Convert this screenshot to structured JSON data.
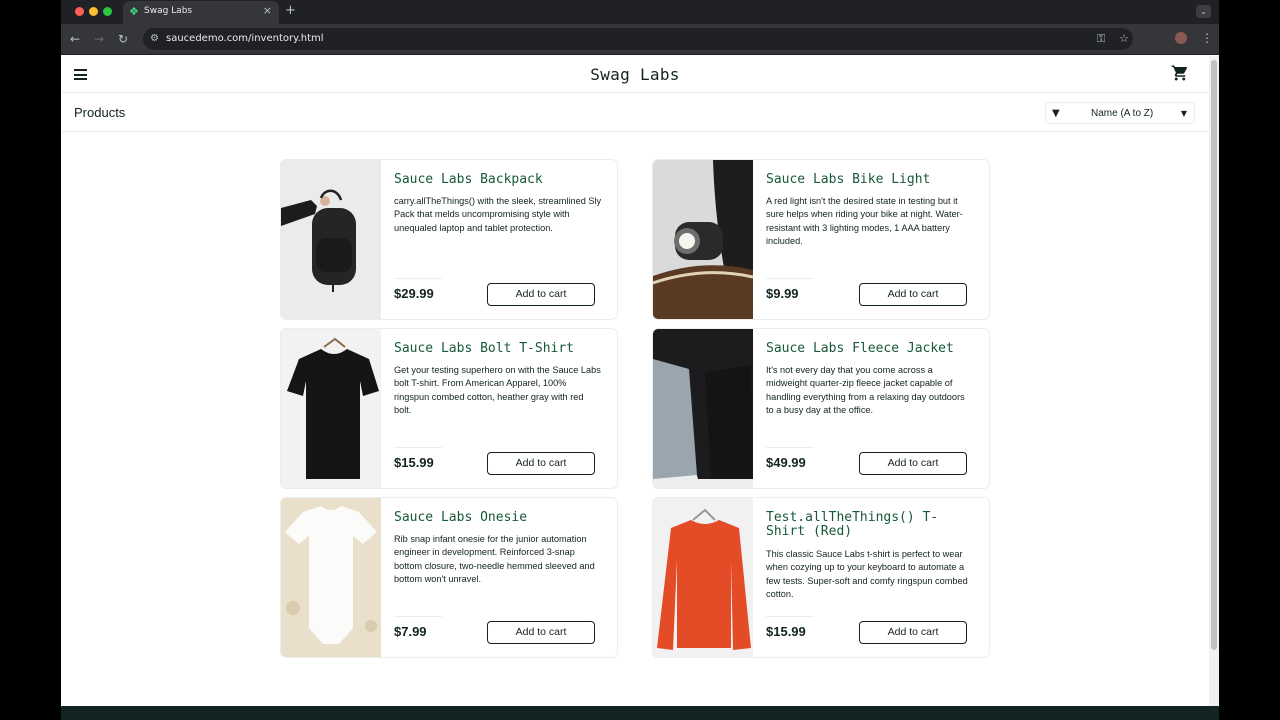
{
  "browser": {
    "tab_title": "Swag Labs",
    "url": "saucedemo.com/inventory.html",
    "colors": {
      "chrome_dark": "#202124",
      "chrome_toolbar": "#35363a",
      "tab_favicon": "#3ddc84"
    }
  },
  "header": {
    "logo": "Swag Labs",
    "menu_icon": "hamburger-menu-icon",
    "cart_icon": "shopping-cart-icon"
  },
  "secondary": {
    "title": "Products",
    "sort": {
      "icon": "funnel-icon",
      "selected": "Name (A to Z)"
    }
  },
  "colors": {
    "text": "#132322",
    "item_name": "#18583a",
    "border": "#ededed"
  },
  "products": [
    {
      "name": "Sauce Labs Backpack",
      "description": "carry.allTheThings() with the sleek, streamlined Sly Pack that melds uncompromising style with unequaled laptop and tablet protection.",
      "price": "$29.99",
      "button": "Add to cart"
    },
    {
      "name": "Sauce Labs Bike Light",
      "description": "A red light isn't the desired state in testing but it sure helps when riding your bike at night. Water-resistant with 3 lighting modes, 1 AAA battery included.",
      "price": "$9.99",
      "button": "Add to cart"
    },
    {
      "name": "Sauce Labs Bolt T-Shirt",
      "description": "Get your testing superhero on with the Sauce Labs bolt T-shirt. From American Apparel, 100% ringspun combed cotton, heather gray with red bolt.",
      "price": "$15.99",
      "button": "Add to cart"
    },
    {
      "name": "Sauce Labs Fleece Jacket",
      "description": "It's not every day that you come across a midweight quarter-zip fleece jacket capable of handling everything from a relaxing day outdoors to a busy day at the office.",
      "price": "$49.99",
      "button": "Add to cart"
    },
    {
      "name": "Sauce Labs Onesie",
      "description": "Rib snap infant onesie for the junior automation engineer in development. Reinforced 3-snap bottom closure, two-needle hemmed sleeved and bottom won't unravel.",
      "price": "$7.99",
      "button": "Add to cart"
    },
    {
      "name": "Test.allTheThings() T-Shirt (Red)",
      "description": "This classic Sauce Labs t-shirt is perfect to wear when cozying up to your keyboard to automate a few tests. Super-soft and comfy ringspun combed cotton.",
      "price": "$15.99",
      "button": "Add to cart"
    }
  ]
}
